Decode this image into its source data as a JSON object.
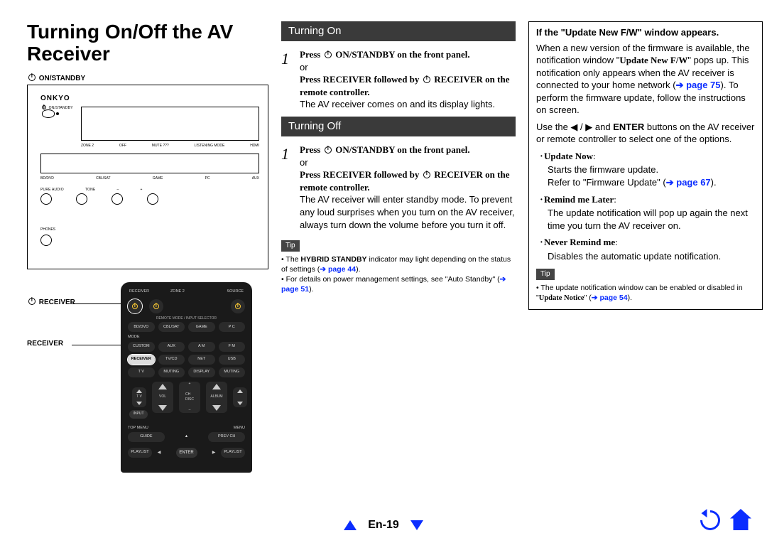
{
  "page": {
    "title": "Turning On/Off the AV Receiver",
    "footer_label": "En-19"
  },
  "left": {
    "callout_onstandby": "ON/STANDBY",
    "brand": "ONKYO",
    "pwr_text": "ON/STANDBY",
    "tinylabels": [
      "ZONE 2",
      "OFF",
      "MUTE ???",
      "LISTENING MODE",
      "HDMI"
    ],
    "btn_row": [
      "BD/DVD",
      "CBL/SAT",
      "GAME",
      "PC",
      "AUX"
    ],
    "tinycaption": [
      "PURE AUDIO",
      "TONE",
      "–",
      "+"
    ],
    "phones": "PHONES",
    "remote_label_1": "RECEIVER",
    "remote_label_2": "RECEIVER",
    "remote": {
      "top": {
        "receiver": "RECEIVER",
        "zone2": "ZONE 2",
        "source": "SOURCE"
      },
      "sub": "REMOTE MODE / INPUT SELECTOR",
      "rows": [
        [
          "BD/DVD",
          "CBL/SAT",
          "GAME",
          "P C"
        ],
        [
          "CUSTOM",
          "AUX",
          "A M",
          "F M"
        ],
        [
          "RECEIVER",
          "TV/CD",
          "NET",
          "USB"
        ],
        [
          "T V",
          "MUTING",
          "DISPLAY",
          "MUTING"
        ]
      ],
      "rowlabel_mode": "MODE",
      "nav": {
        "tv": "T V",
        "vol": "VOL",
        "ch": "CH\nDISC",
        "album": "ALBUM",
        "input": "INPUT",
        "plus": "+"
      },
      "menu_row": {
        "top_menu": "TOP MENU",
        "menu": "MENU"
      },
      "bottom_rows": [
        [
          "GUIDE",
          "",
          "",
          "PREV CH"
        ],
        [
          "PLAYLIST",
          "",
          "ENTER",
          "",
          "PLAYLIST"
        ]
      ]
    }
  },
  "mid": {
    "turning_on": "Turning On",
    "step_num": "1",
    "on_press_a": "Press ",
    "on_press_b": "ON/STANDBY on the front panel.",
    "or": "or",
    "on_press2_a": "Press RECEIVER followed by ",
    "on_press2_b": "RECEIVER on the remote controller.",
    "on_result": "The AV receiver comes on and its display lights.",
    "turning_off": "Turning Off",
    "off_press_a": "Press ",
    "off_press_b": "ON/STANDBY on the front panel.",
    "off_press2_a": "Press RECEIVER followed by ",
    "off_press2_b": "RECEIVER on the remote controller.",
    "off_result": "The AV receiver will enter standby mode. To prevent any loud surprises when you turn on the AV receiver, always turn down the volume before you turn it off.",
    "tip_label": "Tip",
    "tip_line1_a": "The ",
    "tip_line1_b": "HYBRID STANDBY",
    "tip_line1_c": " indicator may light depending on the status of settings (",
    "tip_link1_arrow": "➔ ",
    "tip_link1": "page 44",
    "tip_line1_d": ").",
    "tip_line2_a": "For details on power management settings, see \"Auto Standby\" (",
    "tip_link2_arrow": "➔ ",
    "tip_link2": "page 51",
    "tip_line2_b": ")."
  },
  "right": {
    "head": "If the \"Update New F/W\" window appears.",
    "p1_a": "When a new version of the firmware is available, the notification window \"",
    "p1_b": "Update New F/W",
    "p1_c": "\" pops up. This notification only appears when the AV receiver is connected to your home network (",
    "p1_link_arrow": "➔ ",
    "p1_link": "page 75",
    "p1_d": "). To perform the firmware update, follow the instructions on screen.",
    "p2_a": "Use the ",
    "p2_b": " and ",
    "p2_c": "ENTER",
    "p2_d": " buttons on the AV receiver or remote controller to select one of the options.",
    "opt1_label": "Update Now",
    "opt1_colon": ":",
    "opt1_body_a": "Starts the firmware update.",
    "opt1_body_b": "Refer to \"Firmware Update\" (",
    "opt1_link_arrow": "➔ ",
    "opt1_link": "page 67",
    "opt1_body_c": ").",
    "opt2_label": "Remind me Later",
    "opt2_colon": ":",
    "opt2_body": "The update notification will pop up again the next time you turn the AV receiver on.",
    "opt3_label": "Never Remind me",
    "opt3_colon": ":",
    "opt3_body": "Disables the automatic update notification.",
    "tip_label": "Tip",
    "tip_body_a": "The update notification window can be enabled or disabled in \"",
    "tip_body_b": "Update Notice",
    "tip_body_c": "\" (",
    "tip_link_arrow": "➔ ",
    "tip_link": "page 54",
    "tip_body_d": ")."
  }
}
